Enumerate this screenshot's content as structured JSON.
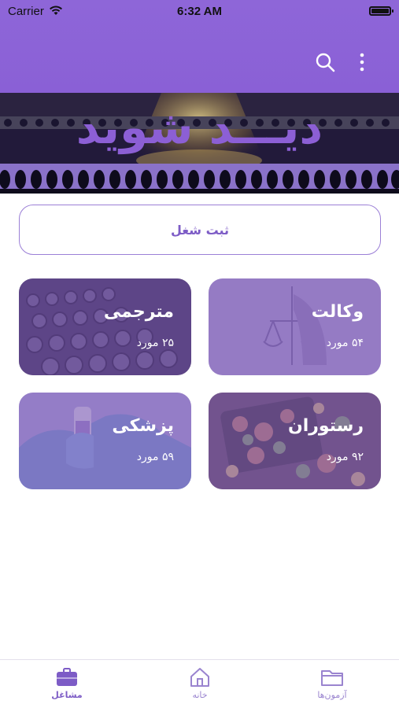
{
  "status_bar": {
    "carrier": "Carrier",
    "time": "6:32 AM"
  },
  "header": {
    "search_icon": "search-icon",
    "menu_icon": "more-vertical-icon",
    "background_color": "#8a60d6"
  },
  "banner": {
    "logo_text": "دیـــد شوید"
  },
  "register_button": {
    "label": "ثبت شغل"
  },
  "job_categories": [
    {
      "title": "مترجمی",
      "count": "۲۵ مورد"
    },
    {
      "title": "وکالت",
      "count": "۵۴ مورد"
    },
    {
      "title": "پزشکی",
      "count": "۵۹ مورد"
    },
    {
      "title": "رستوران",
      "count": "۹۲ مورد"
    }
  ],
  "tabbar": {
    "jobs_label": "مشاغل",
    "home_label": "خانه",
    "exams_label": "آزمون‌ها",
    "active_color": "#7d5cc6",
    "inactive_color": "#9a84cf"
  }
}
